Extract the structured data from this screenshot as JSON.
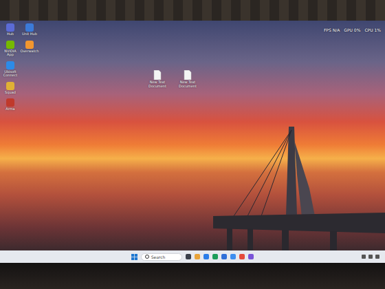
{
  "desktop": {
    "icon_rows": [
      [
        {
          "label": "Hub"
        },
        {
          "label": "Unit Hub"
        }
      ],
      [
        {
          "label": "NVIDIA App"
        },
        {
          "label": "Overwatch"
        }
      ],
      [
        {
          "label": "Ubisoft Connect"
        }
      ],
      [
        {
          "label": "Squad"
        }
      ],
      [
        {
          "label": "Arma"
        }
      ]
    ],
    "files": [
      {
        "label": "New Text Document"
      },
      {
        "label": "New Text Document"
      }
    ]
  },
  "overlay": {
    "items": [
      "FPS N/A",
      "GPU 0%",
      "CPU 1%"
    ]
  },
  "taskbar": {
    "search": {
      "placeholder": "Search"
    },
    "pinned": [
      {
        "color": "#3a3f4a"
      },
      {
        "color": "#e8a33a"
      },
      {
        "color": "#2b7de9"
      },
      {
        "color": "#1c9d5a"
      },
      {
        "color": "#2f6fd8"
      },
      {
        "color": "#3d8ef0"
      },
      {
        "color": "#e54b3c"
      },
      {
        "color": "#7a54d8"
      }
    ]
  }
}
